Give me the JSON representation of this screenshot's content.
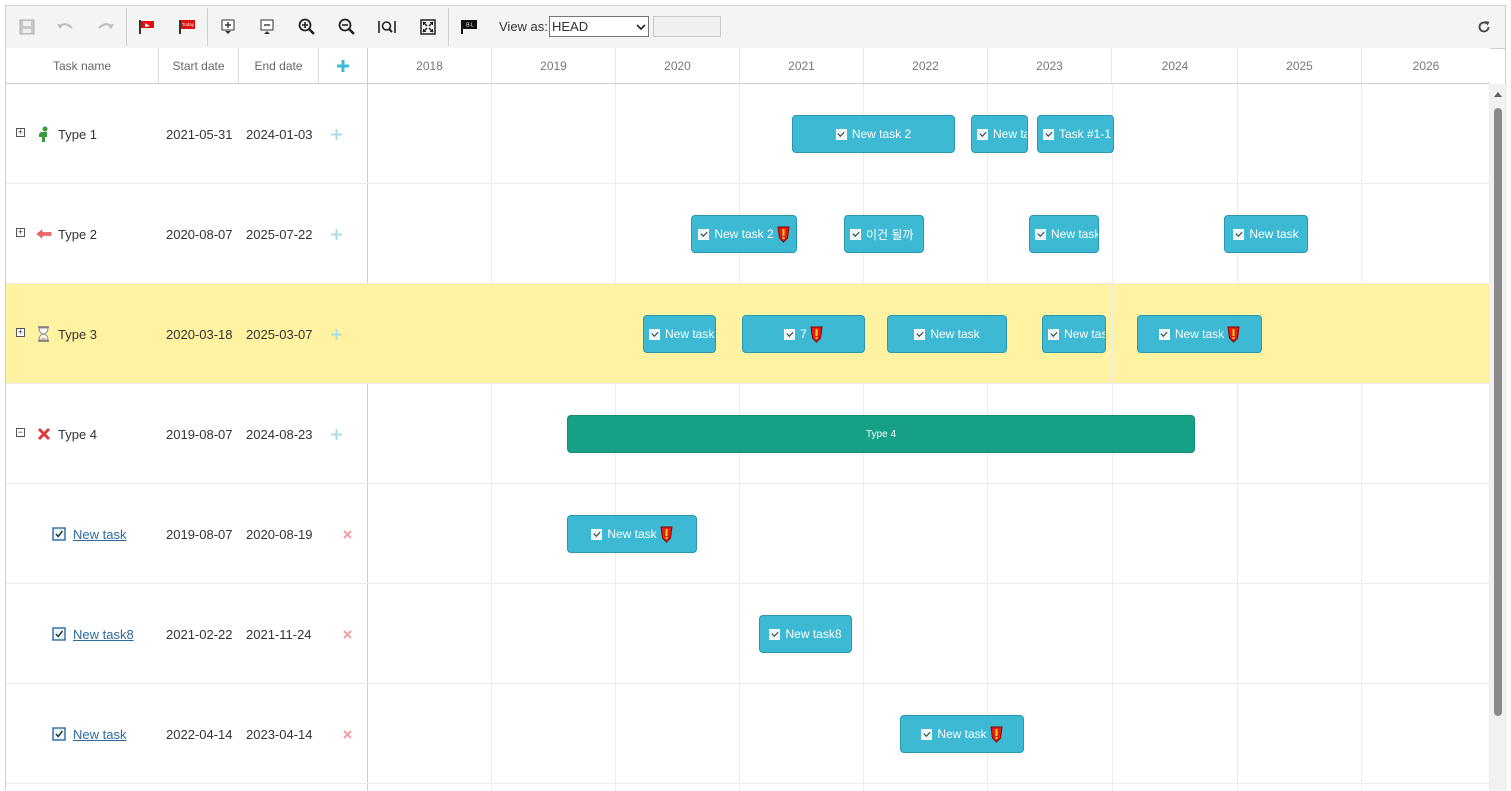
{
  "toolbar": {
    "view_as_label": "View as:",
    "view_as_value": "HEAD",
    "icons": [
      "save-icon",
      "undo-icon",
      "redo-icon",
      "marker-flag-icon",
      "today-flag-icon",
      "expand-all-icon",
      "collapse-all-icon",
      "zoom-in-icon",
      "zoom-out-icon",
      "zoom-to-fit-icon",
      "fullscreen-icon",
      "baseline-icon",
      "refresh-icon"
    ],
    "today_icon_text": "Today",
    "baseline_icon_text": "B-L"
  },
  "grid": {
    "columns": [
      "Task name",
      "Start date",
      "End date"
    ],
    "rows": [
      {
        "name": "Type 1",
        "start": "2021-05-31",
        "end": "2024-01-03"
      },
      {
        "name": "Type 2",
        "start": "2020-08-07",
        "end": "2025-07-22"
      },
      {
        "name": "Type 3",
        "start": "2020-03-18",
        "end": "2025-03-07"
      },
      {
        "name": "Type 4",
        "start": "2019-08-07",
        "end": "2024-08-23"
      },
      {
        "name": "New task",
        "start": "2019-08-07",
        "end": "2020-08-19"
      },
      {
        "name": "New task8",
        "start": "2021-02-22",
        "end": "2021-11-24"
      },
      {
        "name": "New task",
        "start": "2022-04-14",
        "end": "2023-04-14"
      }
    ]
  },
  "timeline": {
    "years": [
      "2018",
      "2019",
      "2020",
      "2021",
      "2022",
      "2023",
      "2024",
      "2025",
      "2026"
    ],
    "bars": {
      "r1": [
        "New task 2",
        "New task",
        "Task #1-1"
      ],
      "r2": [
        "New task 2",
        "이건 될까",
        "New task",
        "New task"
      ],
      "r3": [
        "New task",
        "7",
        "New task",
        "New task",
        "New task"
      ],
      "r4": [
        "Type 4"
      ],
      "r5": [
        "New task"
      ],
      "r6": [
        "New task8"
      ],
      "r7": [
        "New task"
      ]
    }
  },
  "colors": {
    "task_bar": "#3db9d3",
    "summary_bar": "#16a085",
    "selected_row": "#fff3a1"
  }
}
